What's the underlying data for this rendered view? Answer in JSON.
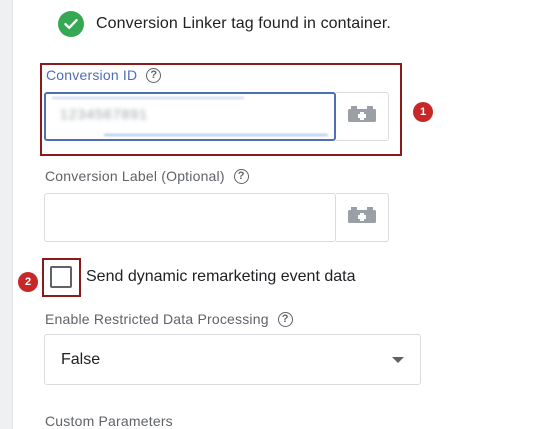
{
  "linker": {
    "message": "Conversion Linker tag found in container."
  },
  "conversion_id": {
    "label": "Conversion ID",
    "help": "?",
    "value": "1234567891"
  },
  "conversion_label": {
    "label": "Conversion Label (Optional)",
    "help": "?",
    "value": ""
  },
  "dynamic_remarketing": {
    "label": "Send dynamic remarketing event data",
    "checked": false
  },
  "restricted_processing": {
    "label": "Enable Restricted Data Processing",
    "help": "?",
    "selected": "False"
  },
  "custom_parameters": {
    "label": "Custom Parameters"
  },
  "annotations": [
    {
      "number": "1"
    },
    {
      "number": "2"
    }
  ],
  "colors": {
    "success": "#34a853",
    "focus_blue": "#4c6fb5",
    "annotation_red": "#c62828",
    "annotation_border": "#8b1a1a",
    "text_primary": "#202124",
    "text_secondary": "#5f6368"
  },
  "icons": {
    "status": "check-circle-icon",
    "variable": "variable-picker-icon",
    "help": "help-circle-icon",
    "dropdown": "dropdown-arrow-icon"
  }
}
